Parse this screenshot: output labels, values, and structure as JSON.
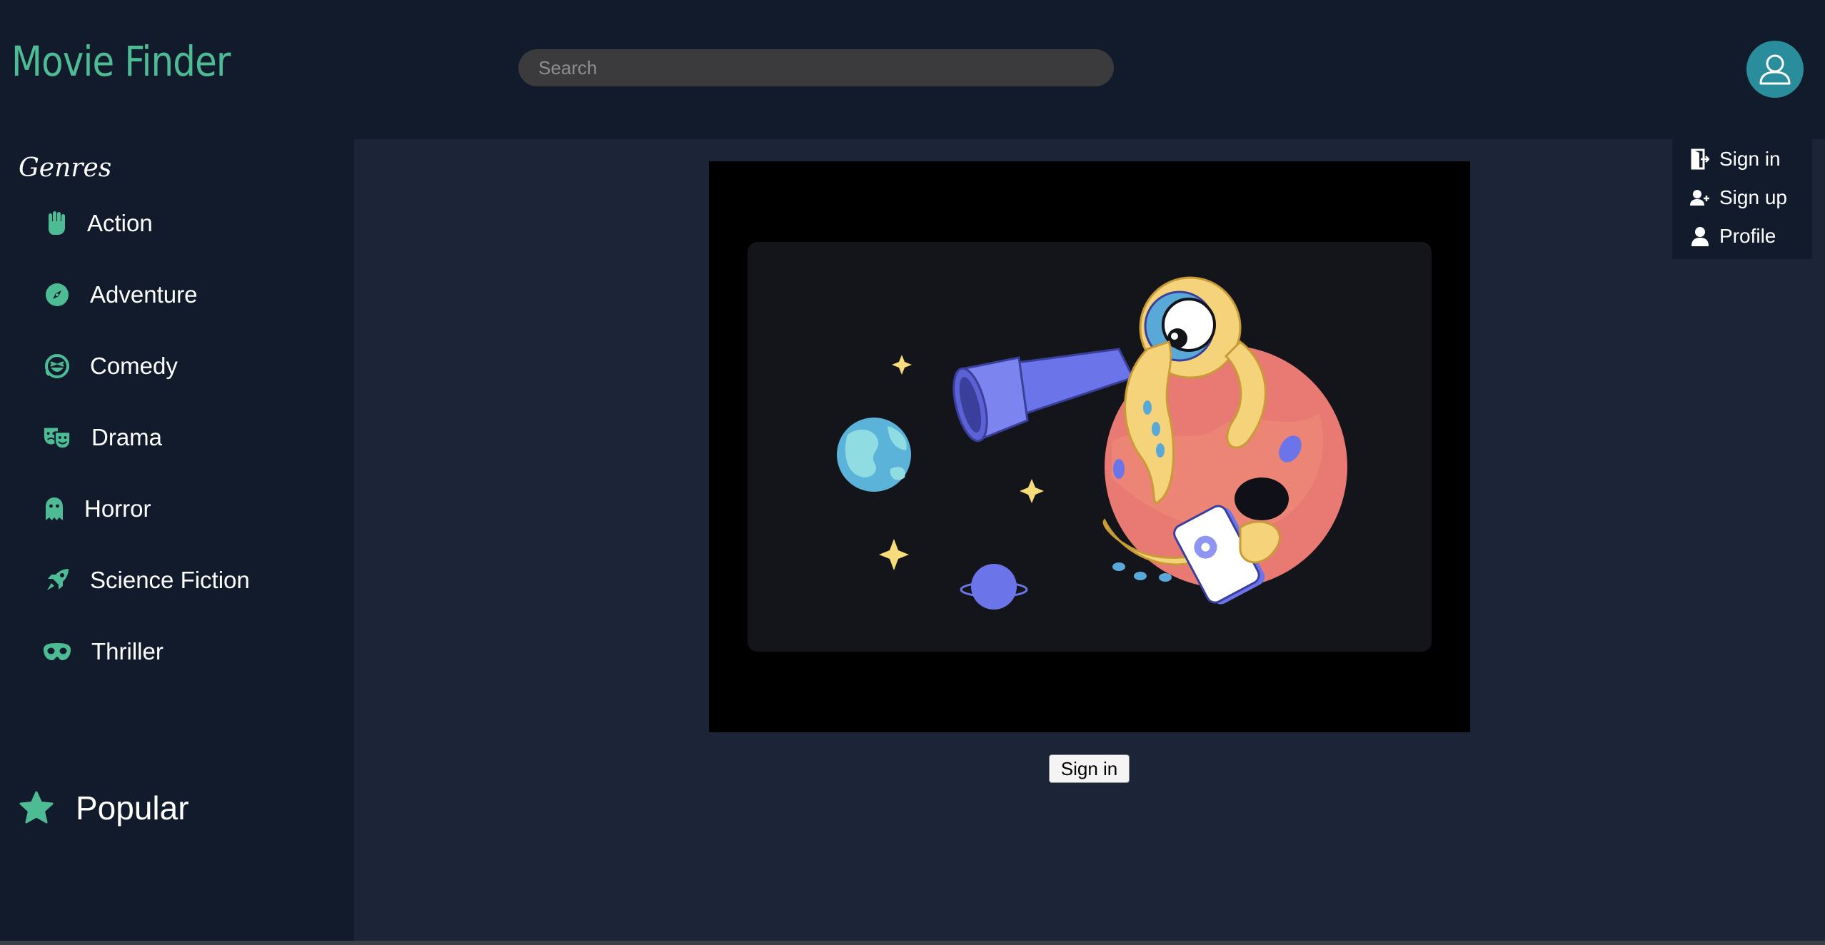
{
  "app": {
    "title": "Movie Finder"
  },
  "search": {
    "placeholder": "Search"
  },
  "sidebar": {
    "title": "Genres",
    "genres": [
      {
        "label": "Action",
        "icon": "fist-icon"
      },
      {
        "label": "Adventure",
        "icon": "compass-icon"
      },
      {
        "label": "Comedy",
        "icon": "laughing-face-icon"
      },
      {
        "label": "Drama",
        "icon": "theater-masks-icon"
      },
      {
        "label": "Horror",
        "icon": "ghost-icon"
      },
      {
        "label": "Science Fiction",
        "icon": "rocket-icon"
      },
      {
        "label": "Thriller",
        "icon": "mask-icon"
      }
    ],
    "popular": {
      "label": "Popular",
      "icon": "star-icon"
    }
  },
  "main": {
    "signin_button": "Sign in",
    "illustration": "octopus-telescope-illustration"
  },
  "user_menu": {
    "items": [
      {
        "label": "Sign in",
        "icon": "sign-in-door-icon"
      },
      {
        "label": "Sign up",
        "icon": "user-plus-icon"
      },
      {
        "label": "Profile",
        "icon": "user-icon"
      }
    ]
  },
  "colors": {
    "accent": "#4dbc95",
    "avatar": "#2a8d9c",
    "header_bg": "#111b2b",
    "content_bg": "#1c2537"
  }
}
